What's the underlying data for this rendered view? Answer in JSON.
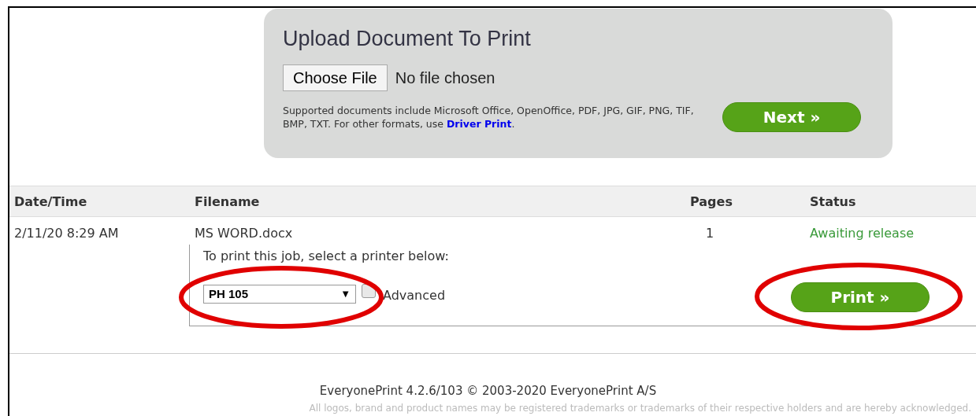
{
  "upload": {
    "title": "Upload Document To Print",
    "choose_button": "Choose File",
    "file_status": "No file chosen",
    "note": "Supported documents include Microsoft Office, OpenOffice, PDF, JPG, GIF, PNG, TIF, BMP, TXT. For other formats, use ",
    "note_link": "Driver Print",
    "note_end": ".",
    "next_button": "Next »"
  },
  "table": {
    "columns": [
      "Date/Time",
      "Filename",
      "Pages",
      "Status"
    ],
    "rows": [
      {
        "datetime": "2/11/20 8:29 AM",
        "filename": "MS WORD.docx",
        "pages": "1",
        "status": "Awaiting release",
        "prompt": "To print this job, select a printer below:",
        "printer": "PH 105",
        "printer_caret": "▼",
        "advanced": {
          "label": "Advanced",
          "checked": false
        },
        "print_button": "Print »"
      }
    ]
  },
  "footer": {
    "version": "EveryonePrint 4.2.6/103 © 2003-2020 EveryonePrint A/S",
    "disclaimer": "All logos, brand and product names may be registered trademarks or trademarks of their respective holders and are hereby acknowledged."
  }
}
